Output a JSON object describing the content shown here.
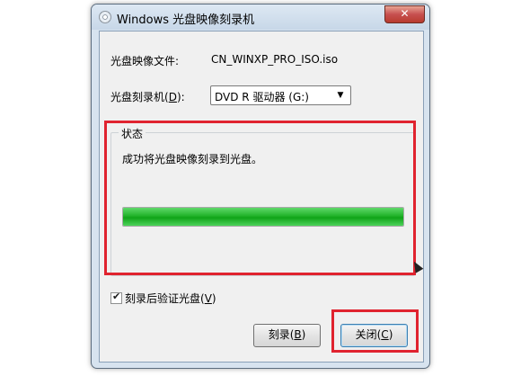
{
  "window": {
    "title": "Windows 光盘映像刻录机",
    "close_label": "✕"
  },
  "form": {
    "image_file_label": "光盘映像文件:",
    "image_file_value": "CN_WINXP_PRO_ISO.iso",
    "burner_label_prefix": "光盘刻录机(",
    "burner_label_key": "D",
    "burner_label_suffix": "):",
    "burner_selected": "DVD R 驱动器 (G:)"
  },
  "status": {
    "group_title": "状态",
    "message": "成功将光盘映像刻录到光盘。",
    "progress_percent": 100
  },
  "verify": {
    "checked": true,
    "label_prefix": "刻录后验证光盘(",
    "label_key": "V",
    "label_suffix": ")"
  },
  "buttons": {
    "burn_prefix": "刻录(",
    "burn_key": "B",
    "burn_suffix": ")",
    "close_prefix": "关闭(",
    "close_key": "C",
    "close_suffix": ")"
  },
  "colors": {
    "highlight": "#e0232f",
    "progress": "#14a81c"
  }
}
